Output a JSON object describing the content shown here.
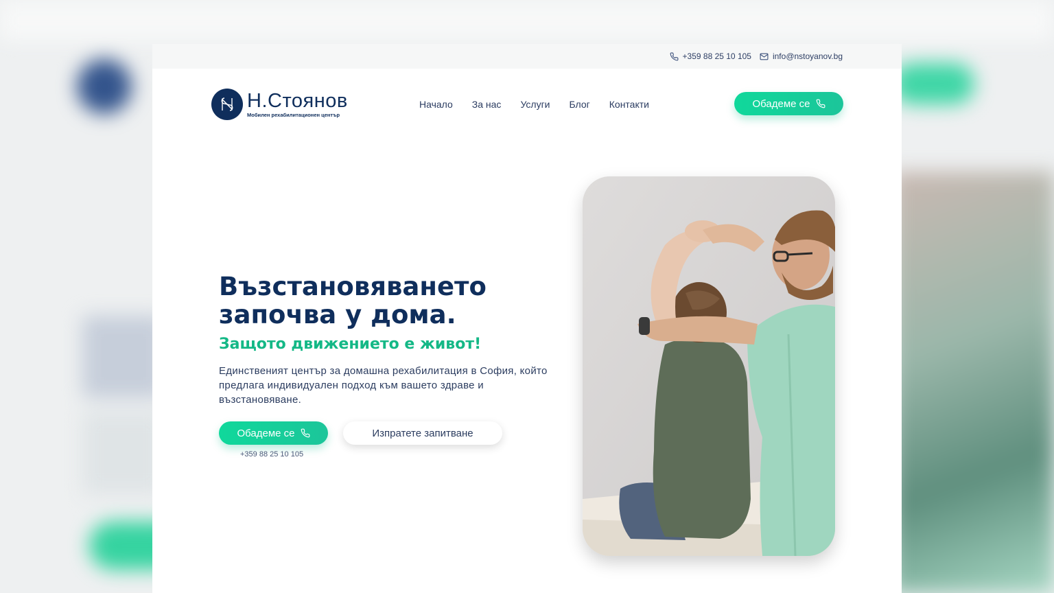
{
  "topbar": {
    "phone": "+359 88 25 10 105",
    "email": "info@nstoyanov.bg"
  },
  "logo": {
    "name": "Н.Стоянов",
    "tagline": "Мобилен рехабилитационен център"
  },
  "nav": {
    "items": [
      "Начало",
      "За нас",
      "Услуги",
      "Блог",
      "Контакти"
    ]
  },
  "header_cta": {
    "label": "Обадеме се"
  },
  "hero": {
    "title_line1": "Възстановяването",
    "title_line2": "започва у дома.",
    "subtitle": "Защото движението е живот!",
    "description": "Единственият център за домашна рехабилитация в София, който предлага индивидуален подход към вашето здраве и възстановяване.",
    "call_label": "Обадеме се",
    "call_phone": "+359 88 25 10 105",
    "inquiry_label": "Изпратете запитване"
  },
  "colors": {
    "brand_navy": "#0f2e5c",
    "accent_green": "#14b886",
    "button_green": "#10d89b"
  },
  "icons": {
    "phone": "phone-icon",
    "email": "mail-icon",
    "logo": "ns-monogram-icon"
  }
}
